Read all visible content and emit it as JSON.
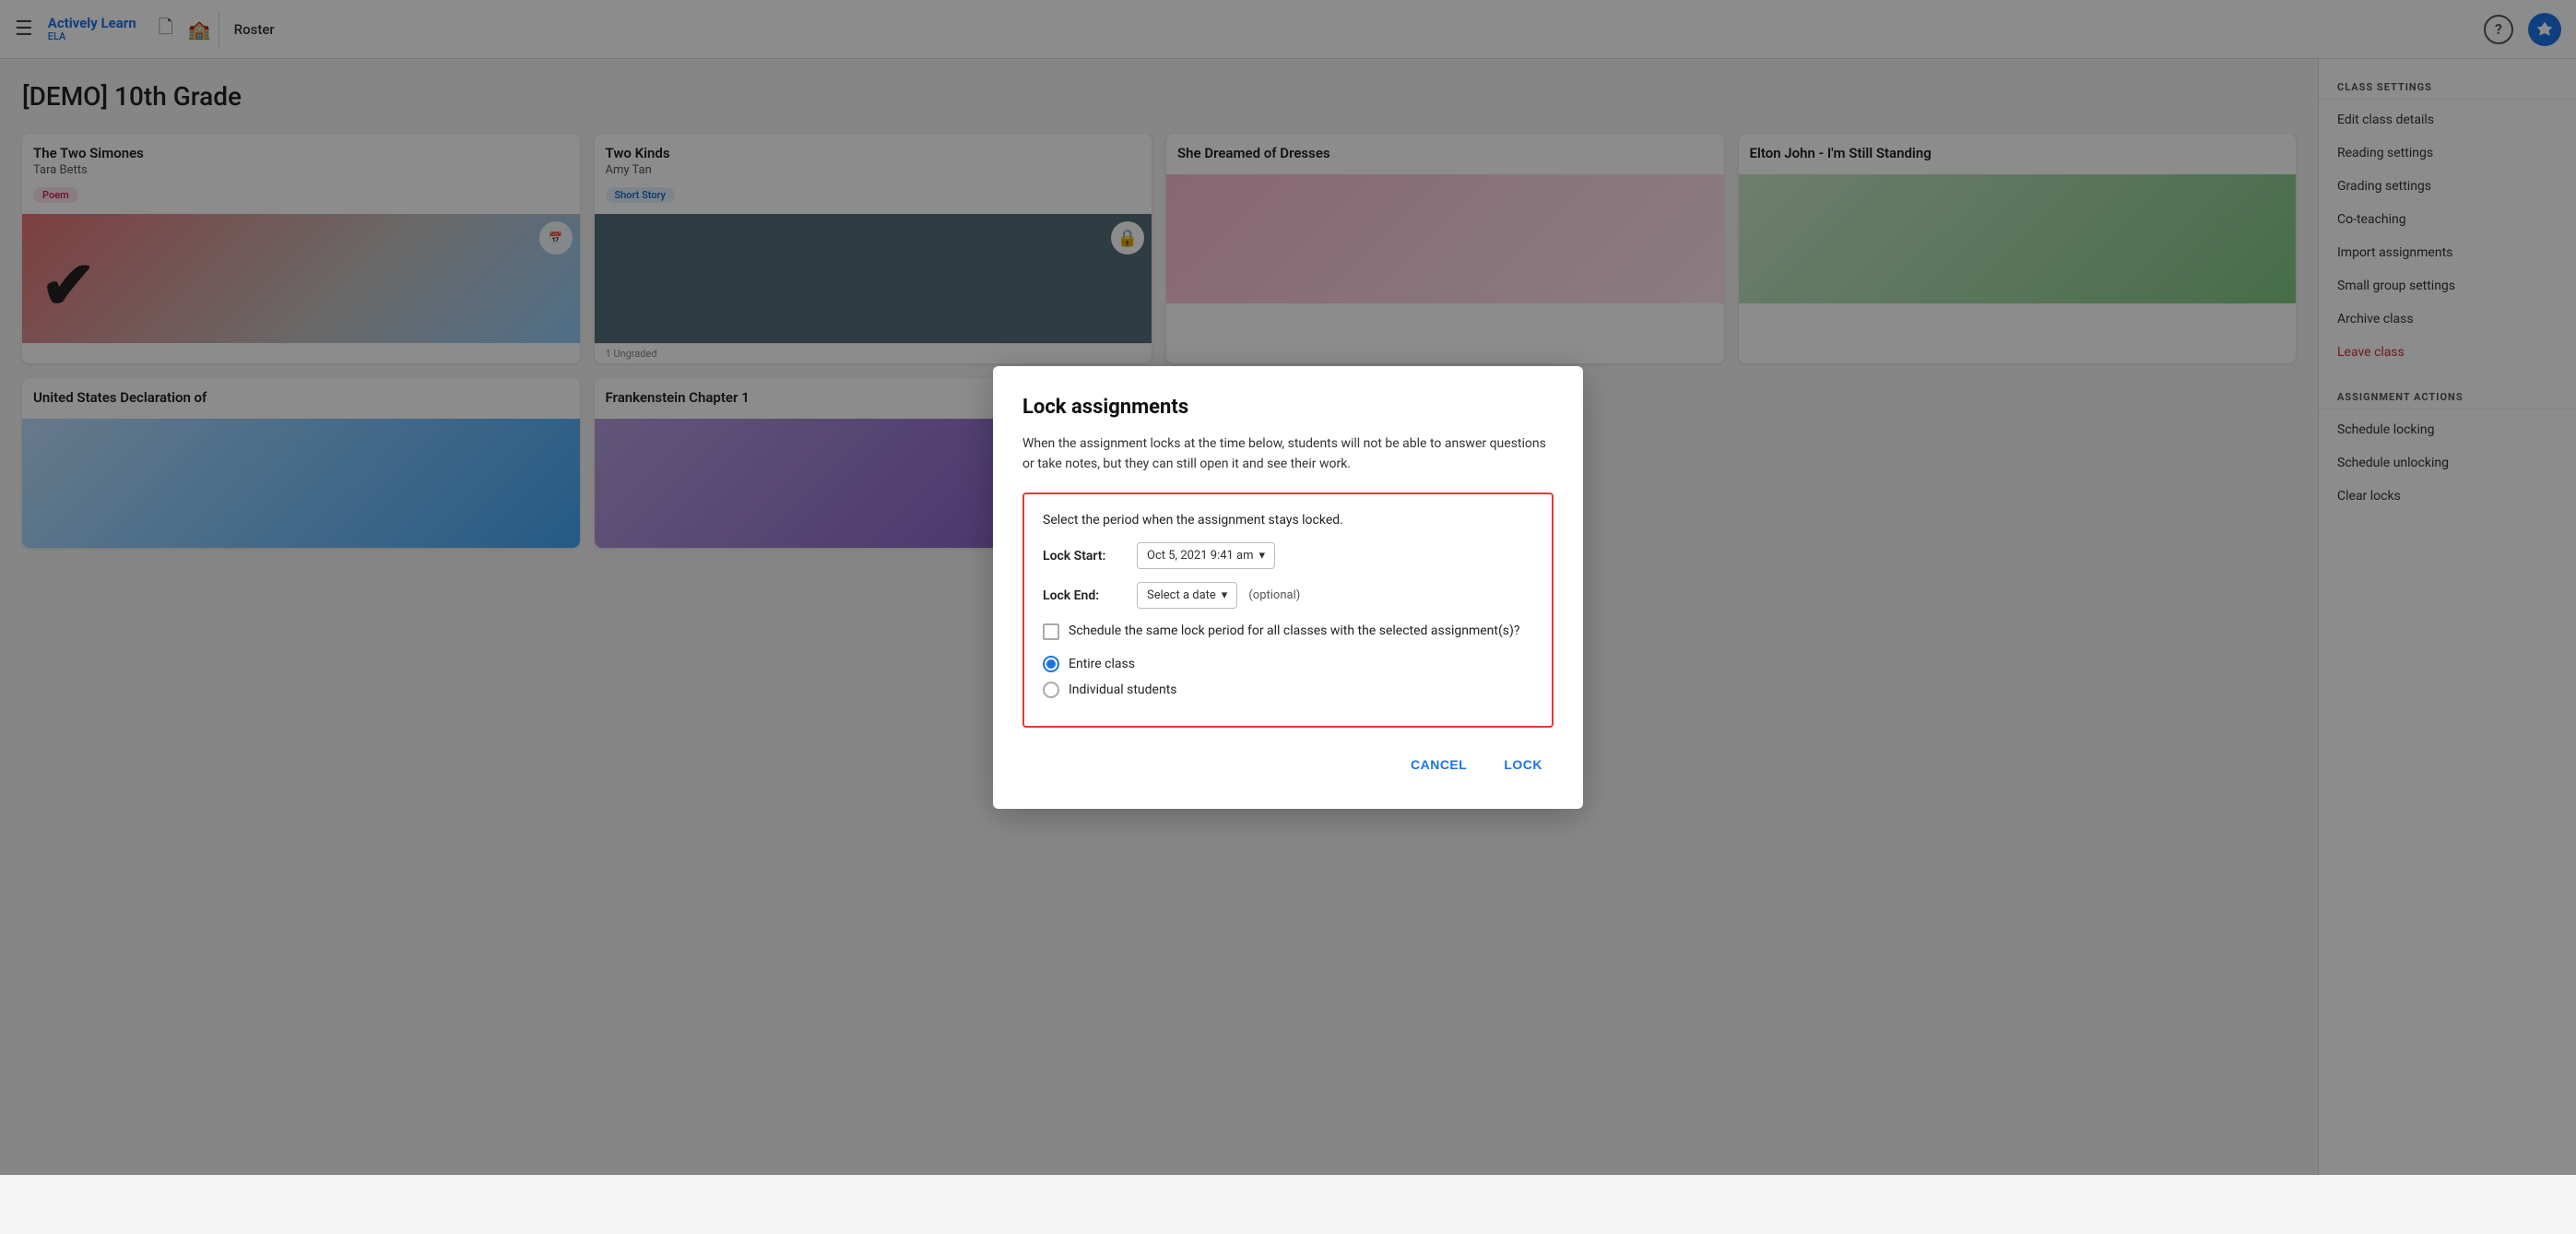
{
  "brand": {
    "name": "Actively Learn",
    "sub": "ELA"
  },
  "nav": {
    "roster_label": "Roster",
    "help_label": "?"
  },
  "page": {
    "title": "[DEMO] 10th Grade"
  },
  "cards": [
    {
      "id": "card-1",
      "title": "The Two Simones",
      "author": "Tara Betts",
      "badge": "Poem",
      "badge_type": "poem",
      "img_type": "poem",
      "has_checkmark": true,
      "has_lock": false,
      "ungraded": ""
    },
    {
      "id": "card-2",
      "title": "Two Kinds",
      "author": "Amy Tan",
      "badge": "Short Story",
      "badge_type": "story",
      "img_type": "story",
      "has_checkmark": false,
      "has_lock": true,
      "ungraded": "1 Ungraded"
    },
    {
      "id": "card-3",
      "title": "She Dreamed of Dresses",
      "author": "",
      "badge": "",
      "badge_type": "",
      "img_type": "dresses",
      "has_checkmark": false,
      "has_lock": false,
      "ungraded": ""
    },
    {
      "id": "card-4",
      "title": "Elton John - I'm Still Standing",
      "author": "",
      "badge": "",
      "badge_type": "",
      "img_type": "elton",
      "has_checkmark": false,
      "has_lock": false,
      "ungraded": ""
    },
    {
      "id": "card-5",
      "title": "United States Declaration of",
      "author": "",
      "badge": "",
      "badge_type": "",
      "img_type": "us",
      "has_checkmark": false,
      "has_lock": false,
      "ungraded": ""
    },
    {
      "id": "card-6",
      "title": "Frankenstein Chapter 1",
      "author": "",
      "badge": "",
      "badge_type": "",
      "img_type": "frank",
      "has_checkmark": false,
      "has_lock": false,
      "ungraded": ""
    }
  ],
  "sidebar": {
    "class_settings_title": "CLASS SETTINGS",
    "items_class": [
      {
        "label": "Edit class details",
        "id": "edit-class-details"
      },
      {
        "label": "Reading settings",
        "id": "reading-settings"
      },
      {
        "label": "Grading settings",
        "id": "grading-settings"
      },
      {
        "label": "Co-teaching",
        "id": "co-teaching"
      },
      {
        "label": "Import assignments",
        "id": "import-assignments"
      },
      {
        "label": "Small group settings",
        "id": "small-group-settings"
      },
      {
        "label": "Archive class",
        "id": "archive-class"
      },
      {
        "label": "Leave class",
        "id": "leave-class",
        "red": true
      }
    ],
    "assignment_actions_title": "ASSIGNMENT ACTIONS",
    "items_assignment": [
      {
        "label": "Schedule locking",
        "id": "schedule-locking"
      },
      {
        "label": "Schedule unlocking",
        "id": "schedule-unlocking"
      },
      {
        "label": "Clear locks",
        "id": "clear-locks"
      }
    ]
  },
  "dialog": {
    "title": "Lock assignments",
    "description": "When the assignment locks at the time below, students will not be able to answer questions or take notes, but they can still open it and see their work.",
    "lock_period_heading": "Select the period when the assignment stays locked.",
    "lock_start_label": "Lock Start:",
    "lock_start_value": "Oct 5, 2021 9:41 am",
    "lock_end_label": "Lock End:",
    "lock_end_value": "Select a date",
    "optional_label": "(optional)",
    "checkbox_label": "Schedule the same lock period for all classes with the selected assignment(s)?",
    "radio_entire": "Entire class",
    "radio_individual": "Individual students",
    "cancel_label": "CANCEL",
    "lock_label": "LOCK"
  }
}
